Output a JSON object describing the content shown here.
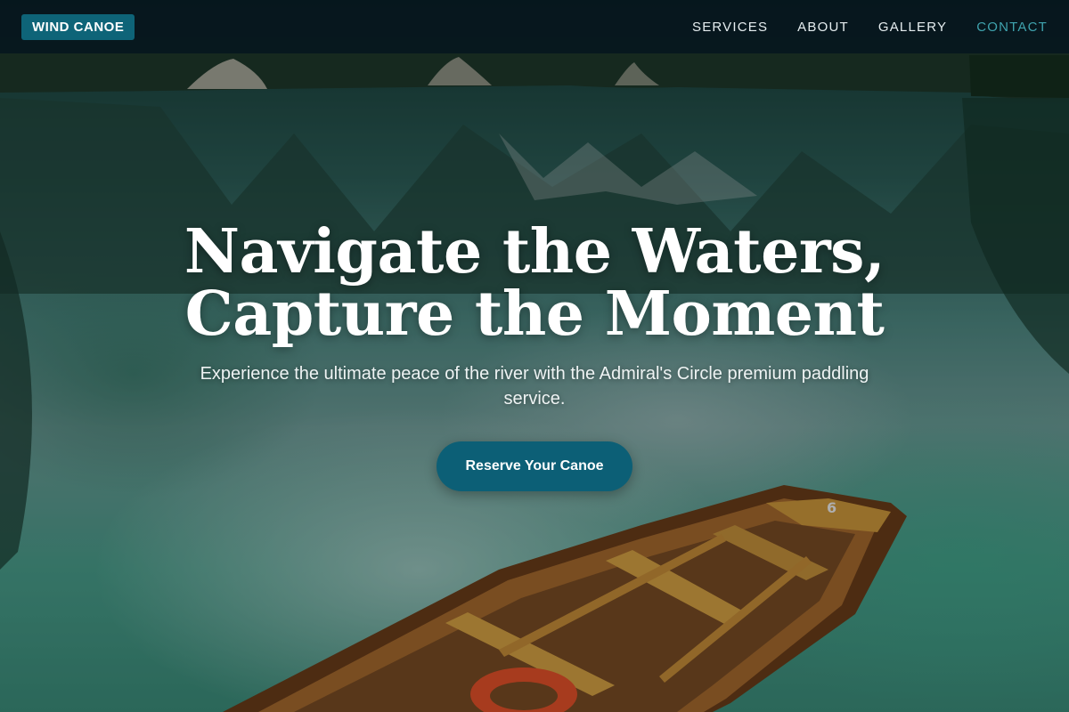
{
  "brand": {
    "label": "WIND CANOE"
  },
  "nav": {
    "items": [
      {
        "label": "SERVICES"
      },
      {
        "label": "ABOUT"
      },
      {
        "label": "GALLERY"
      },
      {
        "label": "CONTACT"
      }
    ],
    "active": "CONTACT"
  },
  "hero": {
    "title_line1": "Navigate the Waters,",
    "title_line2": "Capture the Moment",
    "subtitle": "Experience the ultimate peace of the river with the Admiral's Circle premium paddling service.",
    "cta_label": "Reserve Your Canoe",
    "boat_number": "6"
  },
  "colors": {
    "accent": "#0e6478",
    "active_nav": "#3fa3ae",
    "nav_background": "#06141c",
    "text": "#ffffff"
  }
}
